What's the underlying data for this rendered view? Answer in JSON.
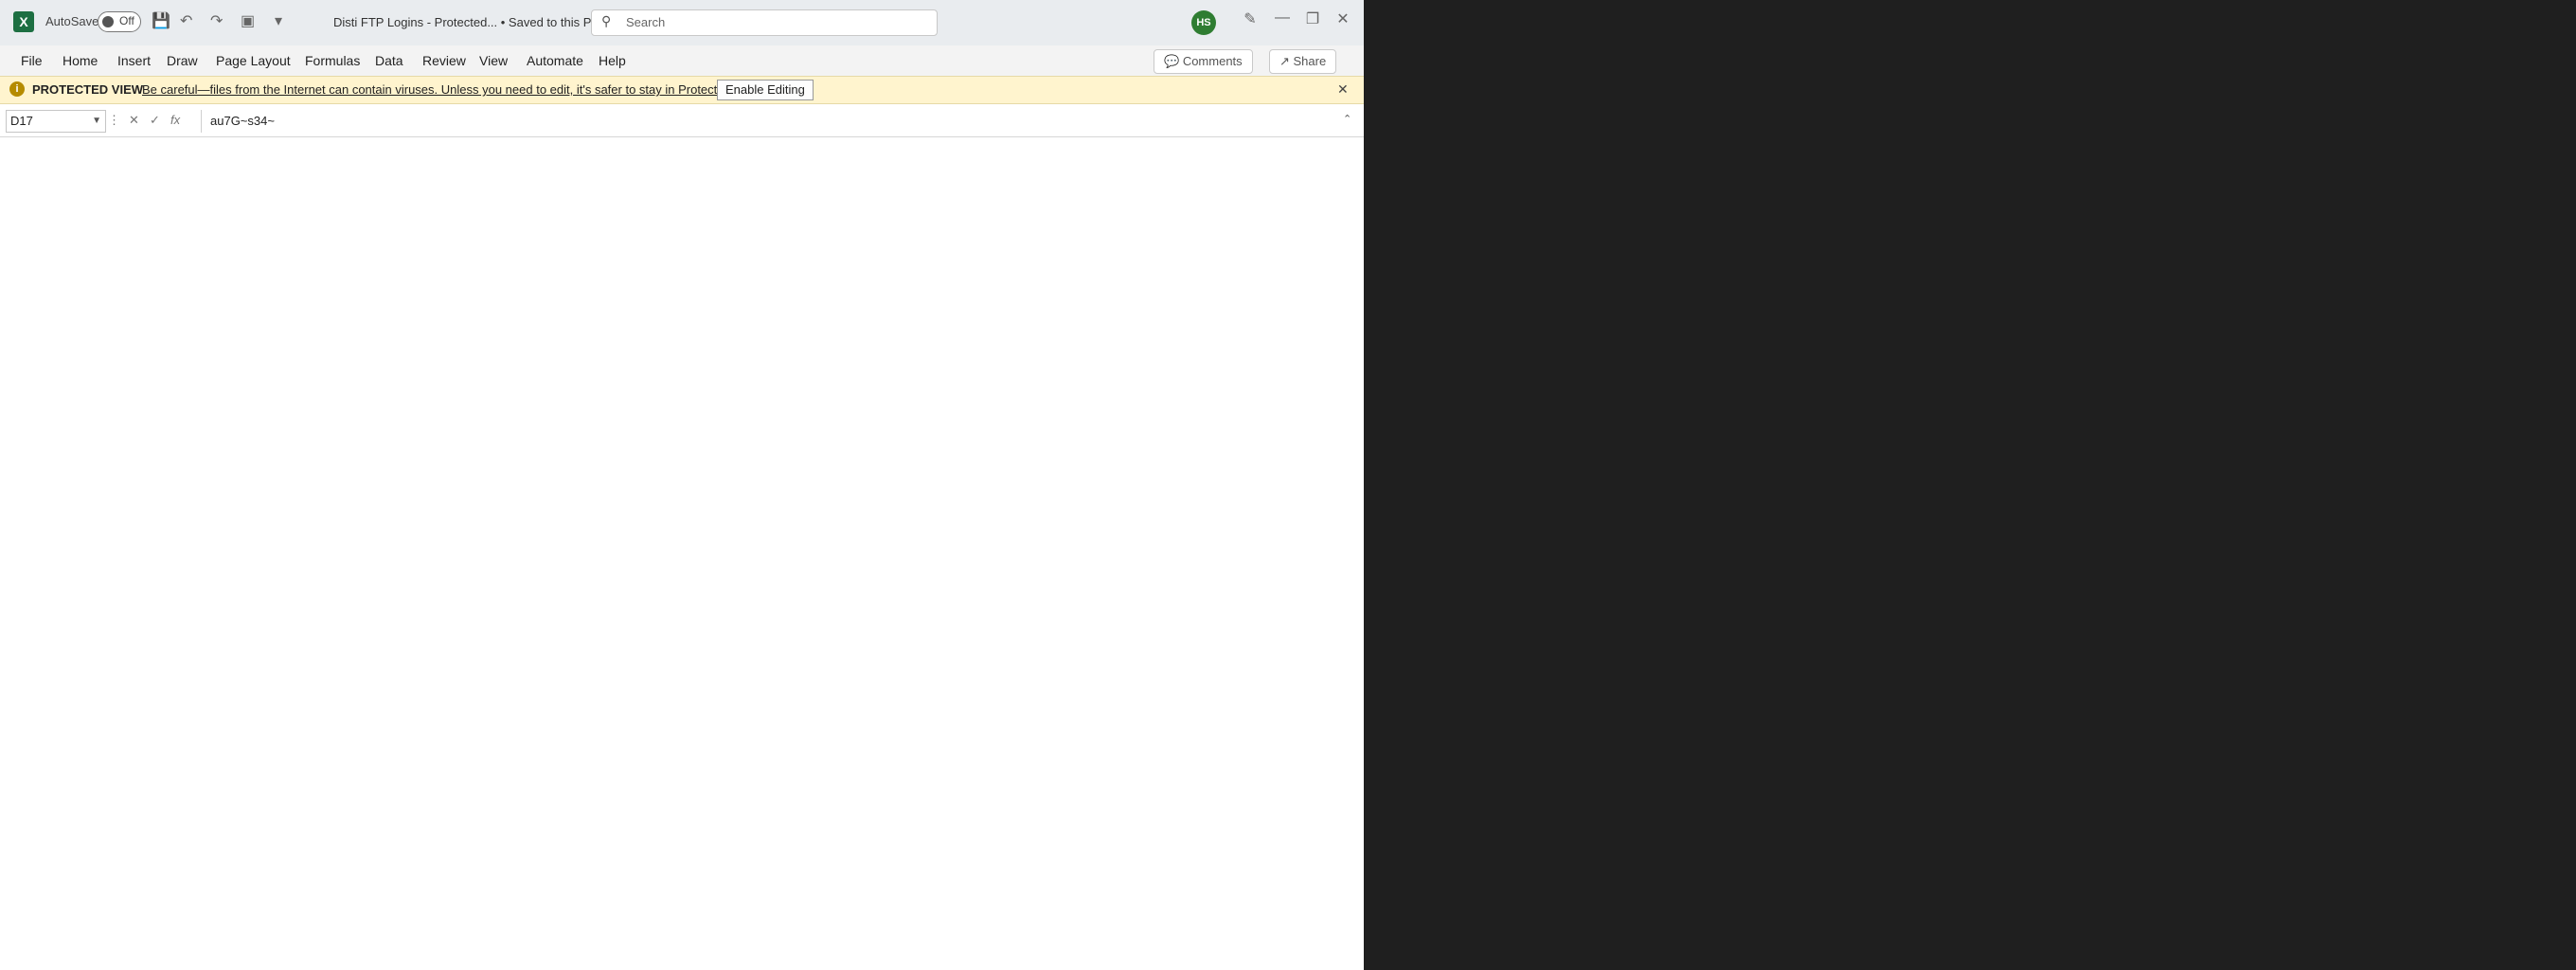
{
  "excel": {
    "titlebar": {
      "autosave_label": "AutoSave",
      "autosave_state": "Off",
      "doc_title": "Disti FTP Logins  -  Protected...  •  Saved to this PC ∨",
      "search_placeholder": "Search",
      "user_initials": "HS"
    },
    "ribbon_tabs": [
      "File",
      "Home",
      "Insert",
      "Draw",
      "Page Layout",
      "Formulas",
      "Data",
      "Review",
      "View",
      "Automate",
      "Help"
    ],
    "ribbon_right": {
      "comments": "Comments",
      "share": "Share"
    },
    "protected_view": {
      "label": "PROTECTED VIEW",
      "message": "Be careful—files from the Internet can contain viruses. Unless you need to edit, it's safer to stay in Protected View.",
      "button": "Enable Editing"
    },
    "formula_bar": {
      "cell_ref": "D17",
      "value": "au7G~s34~"
    }
  }
}
